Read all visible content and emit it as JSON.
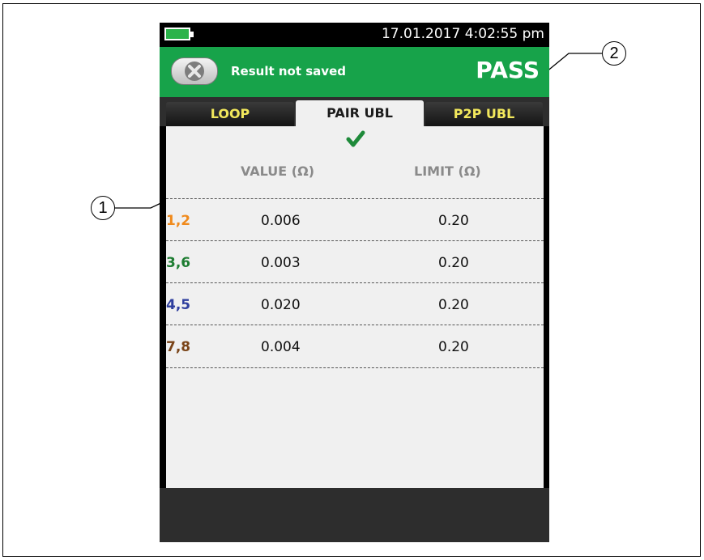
{
  "status": {
    "datetime": "17.01.2017 4:02:55 pm",
    "battery_icon": "battery-icon"
  },
  "result_bar": {
    "message": "Result not saved",
    "status": "PASS",
    "close_icon": "close-x-icon",
    "color": "#17a34a"
  },
  "tabs": [
    {
      "label": "LOOP",
      "active": false
    },
    {
      "label": "PAIR UBL",
      "active": true
    },
    {
      "label": "P2P UBL",
      "active": false
    }
  ],
  "result_icon": "checkmark-icon",
  "columns": {
    "value": "VALUE (Ω)",
    "limit": "LIMIT (Ω)"
  },
  "rows": [
    {
      "pair": "1,2",
      "value": "0.006",
      "limit": "0.20",
      "color": "#f08a1c"
    },
    {
      "pair": "3,6",
      "value": "0.003",
      "limit": "0.20",
      "color": "#1e7d32"
    },
    {
      "pair": "4,5",
      "value": "0.020",
      "limit": "0.20",
      "color": "#2f3f9e"
    },
    {
      "pair": "7,8",
      "value": "0.004",
      "limit": "0.20",
      "color": "#7a4418"
    }
  ],
  "callouts": [
    "1",
    "2"
  ]
}
